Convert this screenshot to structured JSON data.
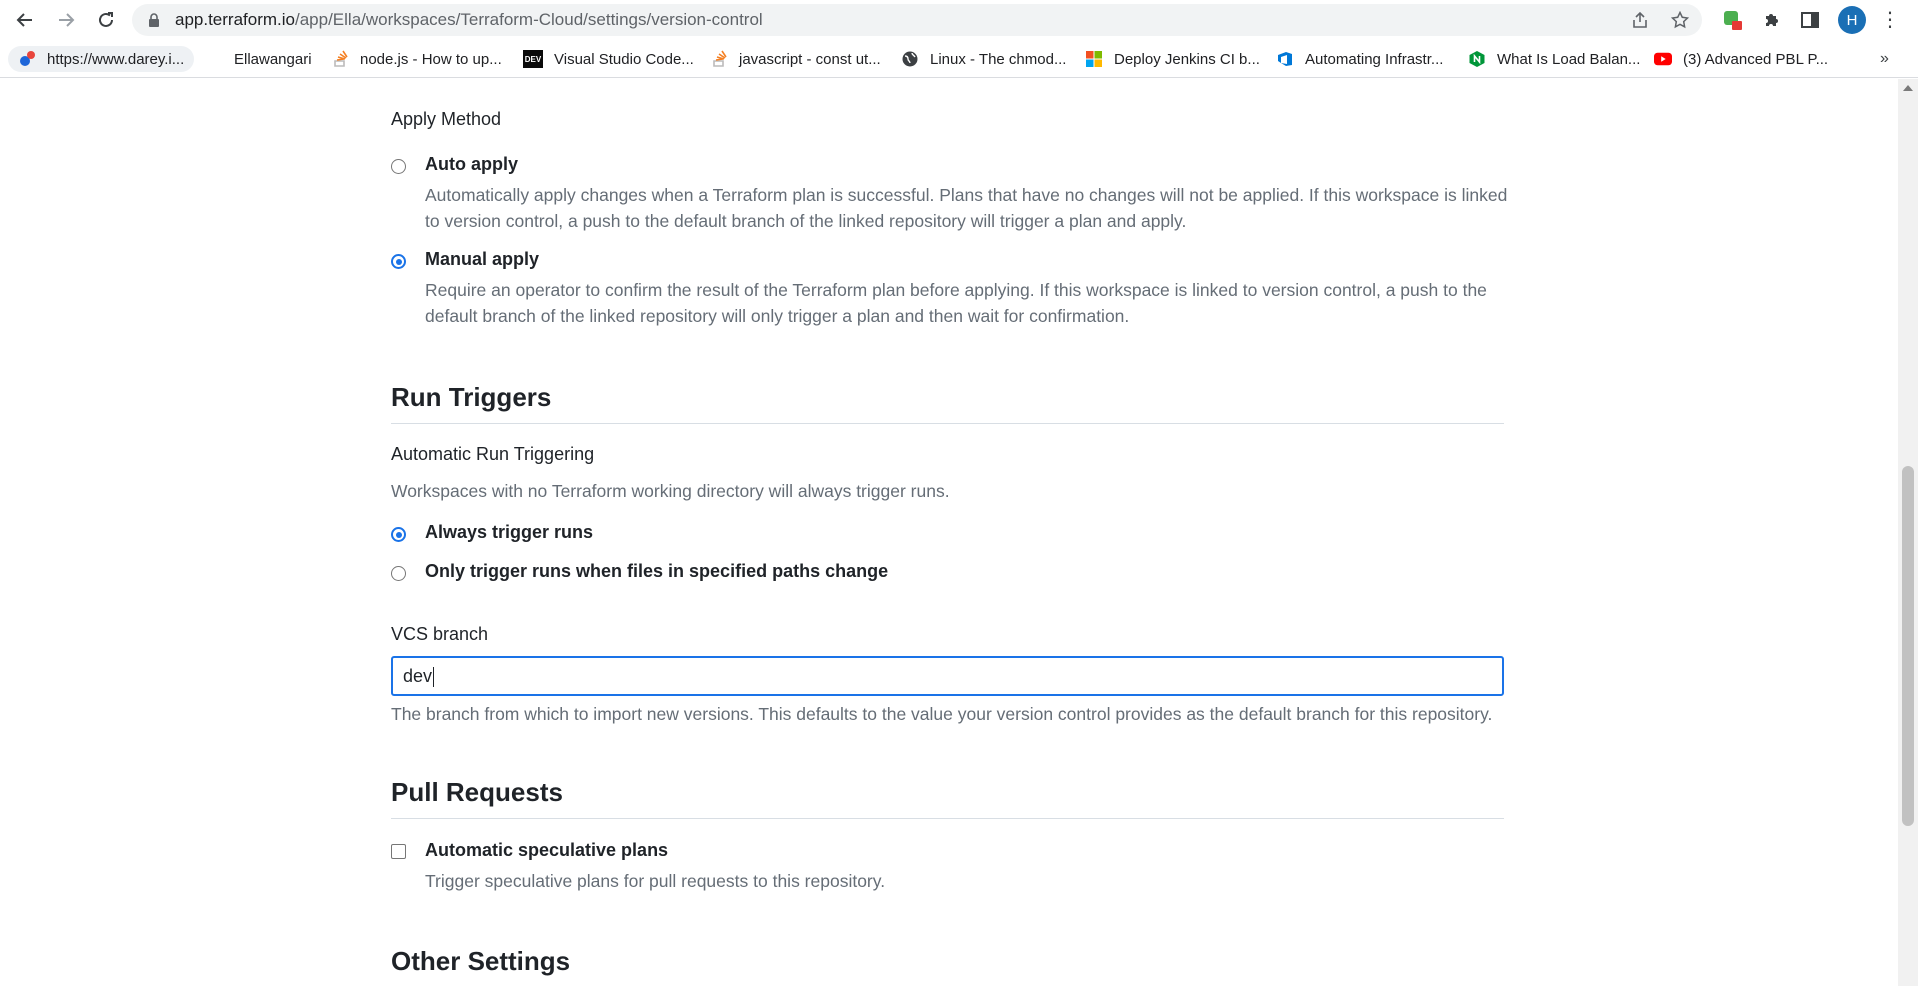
{
  "browser": {
    "url_host": "app.terraform.io",
    "url_path": "/app/Ella/workspaces/Terraform-Cloud/settings/version-control",
    "profile_initial": "H",
    "bookmarks": [
      {
        "label": "https://www.darey.i...",
        "icon": "darey-icon"
      },
      {
        "label": "Ellawangari",
        "icon": "none"
      },
      {
        "label": "node.js - How to up...",
        "icon": "stackoverflow-icon"
      },
      {
        "label": "Visual Studio Code...",
        "icon": "dev-icon"
      },
      {
        "label": "javascript - const ut...",
        "icon": "stackoverflow-icon"
      },
      {
        "label": "Linux - The chmod...",
        "icon": "globe-icon"
      },
      {
        "label": "Deploy Jenkins CI b...",
        "icon": "microsoft-icon"
      },
      {
        "label": "Automating Infrastr...",
        "icon": "azure-devops-icon"
      },
      {
        "label": "What Is Load Balan...",
        "icon": "nginx-icon"
      },
      {
        "label": "(3) Advanced PBL P...",
        "icon": "youtube-icon"
      }
    ]
  },
  "apply_method": {
    "label": "Apply Method",
    "options": [
      {
        "label": "Auto apply",
        "checked": false,
        "description": "Automatically apply changes when a Terraform plan is successful. Plans that have no changes will not be applied. If this workspace is linked to version control, a push to the default branch of the linked repository will trigger a plan and apply."
      },
      {
        "label": "Manual apply",
        "checked": true,
        "description": "Require an operator to confirm the result of the Terraform plan before applying. If this workspace is linked to version control, a push to the default branch of the linked repository will only trigger a plan and then wait for confirmation."
      }
    ]
  },
  "run_triggers": {
    "heading": "Run Triggers",
    "sub_label": "Automatic Run Triggering",
    "sub_description": "Workspaces with no Terraform working directory will always trigger runs.",
    "options": [
      {
        "label": "Always trigger runs",
        "checked": true
      },
      {
        "label": "Only trigger runs when files in specified paths change",
        "checked": false
      }
    ]
  },
  "vcs_branch": {
    "label": "VCS branch",
    "value": "dev",
    "help": "The branch from which to import new versions. This defaults to the value your version control provides as the default branch for this repository."
  },
  "pull_requests": {
    "heading": "Pull Requests",
    "option_label": "Automatic speculative plans",
    "option_description": "Trigger speculative plans for pull requests to this repository."
  },
  "other_settings": {
    "heading": "Other Settings"
  }
}
